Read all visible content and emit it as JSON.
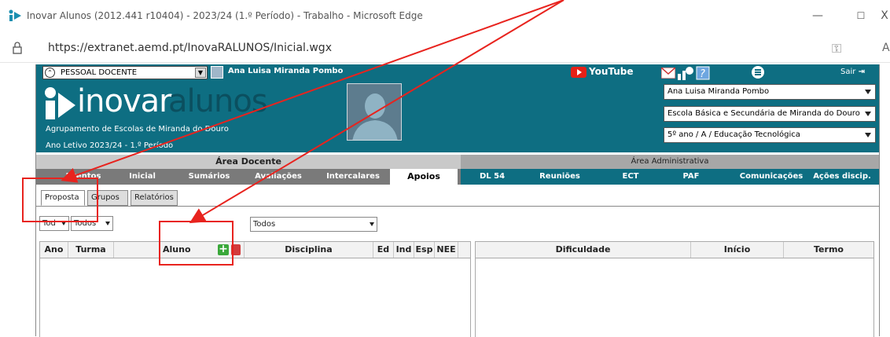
{
  "browser": {
    "window_title": "Inovar Alunos (2012.441 r10404) - 2023/24 (1.º Período) - Trabalho - Microsoft Edge",
    "url": "https://extranet.aemd.pt/InovaRALUNOS/Inicial.wgx",
    "minimize": "—",
    "maximize": "☐",
    "close": "X"
  },
  "header": {
    "role": "PESSOAL DOCENTE",
    "user_name": "Ana Luisa Miranda Pombo",
    "logo_prefix": "inovar",
    "logo_suffix": "alunos",
    "agrupamento": "Agrupamento de Escolas de Miranda do Douro",
    "ano_letivo": "Ano Letivo 2023/24 - 1.º Período",
    "youtube": "YouTube",
    "sair": "Sair",
    "select_user": "Ana Luisa Miranda Pombo",
    "select_school": "Escola Básica e Secundária de Miranda do Douro",
    "select_class": "5º ano / A / Educação Tecnológica"
  },
  "areas": {
    "docente": "Área Docente",
    "administrativa": "Área Administrativa"
  },
  "nav": {
    "docente": [
      "Eventos",
      "Inicial",
      "Sumários",
      "Avaliações",
      "Intercalares",
      "Apoios"
    ],
    "admin": [
      "DL 54",
      "Reuniões",
      "ECT",
      "PAF",
      "Comunicações",
      "Ações discip."
    ],
    "active": "Apoios"
  },
  "subtabs": [
    "Proposta",
    "Grupos",
    "Relatórios"
  ],
  "filters": {
    "f1": "Tod",
    "f2": "Todos",
    "f3": "Todos"
  },
  "grid_left": [
    "Ano",
    "Turma",
    "Aluno",
    "Disciplina",
    "Ed",
    "Ind",
    "Esp",
    "NEE"
  ],
  "grid_right": [
    "Dificuldade",
    "Início",
    "Termo"
  ],
  "colors": {
    "brand": "#0e6e82",
    "annotation": "#e8231e",
    "add": "#3aa83a",
    "delete": "#d23b3b"
  }
}
